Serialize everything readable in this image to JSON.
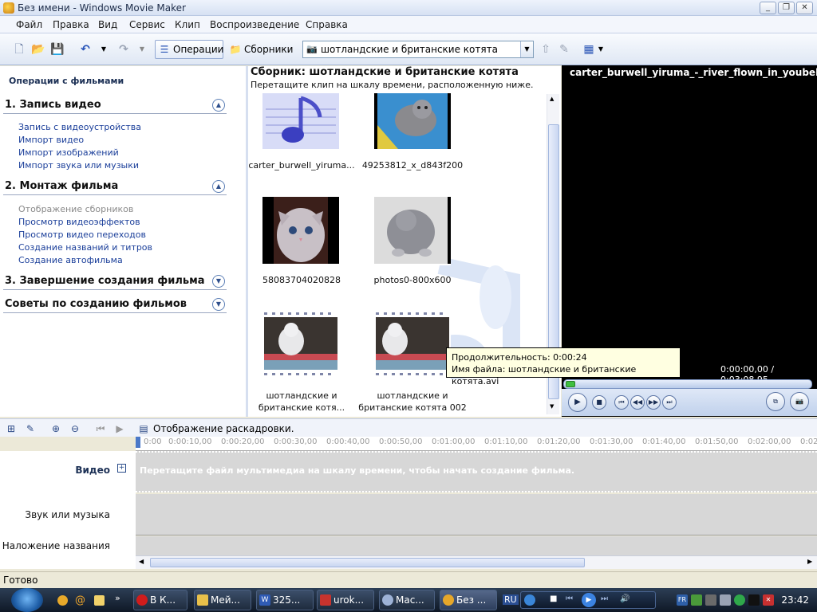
{
  "window": {
    "title": "Без имени - Windows Movie Maker",
    "minimize_glyph": "_",
    "maximize_glyph": "❐",
    "close_glyph": "✕"
  },
  "menu": [
    "Файл",
    "Правка",
    "Вид",
    "Сервис",
    "Клип",
    "Воспроизведение",
    "Справка"
  ],
  "toolbar": {
    "operations_label": "Операции",
    "collections_label": "Сборники",
    "collection_selected": "шотландские и британские котята",
    "icons": [
      "new-project-icon",
      "open-project-icon",
      "save-project-icon",
      "undo-icon",
      "redo-icon",
      "up-level-icon",
      "new-collection-icon",
      "view-options-icon"
    ]
  },
  "tasks": {
    "header": "Операции с фильмами",
    "sections": [
      {
        "title": "1. Запись видео",
        "links": [
          "Запись с видеоустройства",
          "Импорт видео",
          "Импорт изображений",
          "Импорт звука или музыки"
        ]
      },
      {
        "title": "2. Монтаж фильма",
        "links": [
          "Отображение сборников",
          "Просмотр видеоэффектов",
          "Просмотр видео переходов",
          "Создание названий и титров",
          "Создание автофильма"
        ]
      },
      {
        "title": "3. Завершение создания фильма",
        "links": []
      },
      {
        "title": "Советы по созданию фильмов",
        "links": []
      }
    ]
  },
  "collection": {
    "title": "Сборник: шотландские и британские котята",
    "hint": "Перетащите клип на шкалу времени, расположенную ниже.",
    "items": [
      {
        "name": "carter_burwell_yiruma...",
        "kind": "audio"
      },
      {
        "name": "49253812_x_d843f200",
        "kind": "image"
      },
      {
        "name": "58083704020828",
        "kind": "image"
      },
      {
        "name": "photos0-800x600",
        "kind": "image"
      },
      {
        "name": "шотландские и британские котя...",
        "kind": "video"
      },
      {
        "name": "шотландские и британские котята 002",
        "kind": "video"
      }
    ]
  },
  "tooltip": {
    "duration": "Продолжительность:  0:00:24",
    "filename": "Имя файла: шотландские и британские котята.avi"
  },
  "monitor": {
    "clip_name": "carter_burwell_yiruma_-_river_flown_in_youbellas_l...",
    "time": "0:00:00,00 / 0:03:08,95"
  },
  "timeline": {
    "storyboard_label": "Отображение раскадровки.",
    "ticks": [
      "0:00",
      "0:00:10,00",
      "0:00:20,00",
      "0:00:30,00",
      "0:00:40,00",
      "0:00:50,00",
      "0:01:00,00",
      "0:01:10,00",
      "0:01:20,00",
      "0:01:30,00",
      "0:01:40,00",
      "0:01:50,00",
      "0:02:00,00",
      "0:02"
    ],
    "tracks": {
      "video": "Видео",
      "audio": "Звук или музыка",
      "title_overlay": "Наложение названия"
    },
    "video_hint": "Перетащите файл мультимедиа на шкалу времени, чтобы начать создание фильма."
  },
  "status": "Готово",
  "taskbar": {
    "tasks": [
      "В К...",
      "Мей...",
      "325...",
      "urok...",
      "Mac...",
      "Без ..."
    ],
    "clock": "23:42",
    "lang": "RU"
  }
}
